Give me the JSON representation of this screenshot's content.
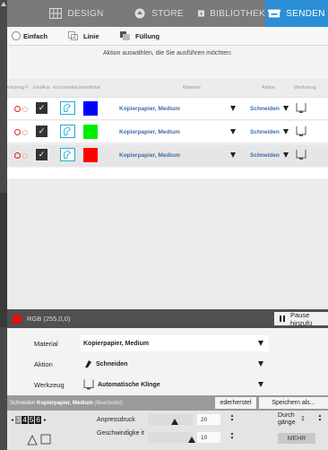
{
  "top_tabs": [
    {
      "label": "DESIGN",
      "icon": "design-grid-icon"
    },
    {
      "label": "STORE",
      "icon": "store-icon"
    },
    {
      "label": "BIBLIOTHEK",
      "icon": "library-icon"
    },
    {
      "label": "SENDEN",
      "icon": "send-cutter-icon",
      "active": true
    }
  ],
  "sub_tabs": [
    {
      "label": "Einfach",
      "icon": "radio-icon"
    },
    {
      "label": "Linie",
      "icon": "line-icon"
    },
    {
      "label": "Füllung",
      "icon": "fill-icon"
    }
  ],
  "instruction": "Aktion auswählen, die Sie ausführen möchten:",
  "table": {
    "headers": [
      "erkzeug-f",
      "Ein/Aus",
      "eschneiden",
      "Linienfarbe",
      "Material",
      "Aktion",
      "Werkzeug"
    ],
    "rows": [
      {
        "color": "#0000ff",
        "material": "Kopierpapier, Medium",
        "action": "Schneiden",
        "selected": false
      },
      {
        "color": "#00ee00",
        "material": "Kopierpapier, Medium",
        "action": "Schneiden",
        "selected": false
      },
      {
        "color": "#ff0000",
        "material": "Kopierpapier, Medium",
        "action": "Schneiden",
        "selected": true
      }
    ]
  },
  "status_bar": {
    "color_label": "RGB (255,0,0)",
    "pause_label": "Pause hinzufü"
  },
  "props": {
    "material_label": "Material",
    "material_value": "Kopierpapier, Medium",
    "action_label": "Aktion",
    "action_value": "Schneiden",
    "tool_label": "Werkzeug",
    "tool_value": "Automatische Klinge"
  },
  "bottom": {
    "header_prefix": "Schneiden",
    "header_material": "Kopierpapier, Medium",
    "header_edited": "(Bearbeitet)",
    "reset_label": "ederherstel",
    "save_label": "Speichern als...",
    "layer_digits": [
      "3",
      "4",
      "5",
      "6"
    ],
    "pressure_label": "Anpressdruck",
    "pressure_value": "20",
    "speed_label": "Geschwindigke it",
    "speed_value": "10",
    "passes_label": "Durch gänge",
    "passes_value": "1",
    "more_label": "MEHR"
  }
}
